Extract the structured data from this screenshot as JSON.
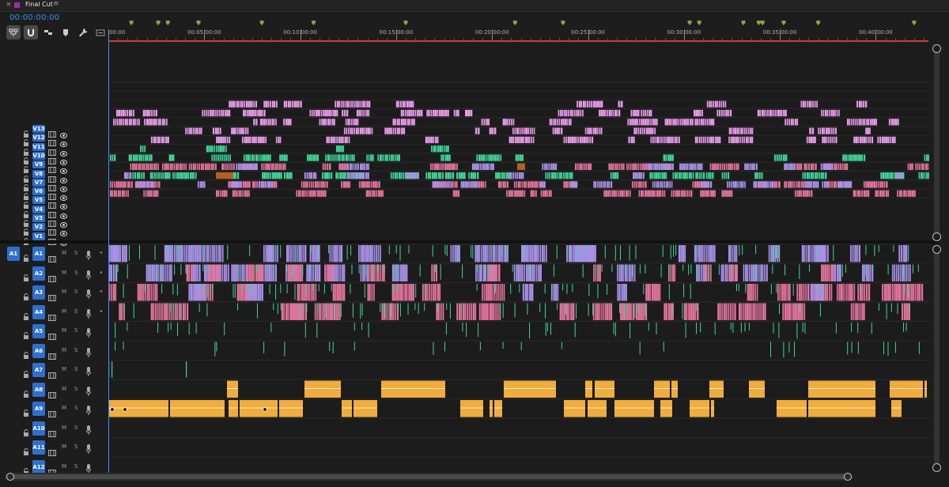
{
  "sequence": {
    "tab_close": "×",
    "title": "Final Cut",
    "menu_glyph": "≡",
    "swatch_color": "#9a2fa6",
    "timecode": "00:00:00:00"
  },
  "toolbar": {
    "tools": [
      {
        "name": "nest-icon",
        "active": true
      },
      {
        "name": "snap-magnet-icon",
        "active": true
      },
      {
        "name": "linked-selection-icon",
        "active": false
      },
      {
        "name": "add-marker-icon",
        "active": false
      },
      {
        "name": "timeline-settings-wrench-icon",
        "active": false
      },
      {
        "name": "captions-icon",
        "active": false
      }
    ]
  },
  "ruler": {
    "labels": [
      ":00:00",
      "00:05:00:00",
      "00:10:00:00",
      "00:15:00:00",
      "00:20:00:00",
      "00:25:00:00",
      "00:30:00:00",
      "00:35:00:00",
      "00:40:00:00"
    ],
    "total_minutes": 44,
    "marker_minutes": [
      1.2,
      2.6,
      3.1,
      4.7,
      8.0,
      10.7,
      15.5,
      21.2,
      23.7,
      30.3,
      30.8,
      33.1,
      33.9,
      34.1,
      35.2,
      37.0,
      42.0
    ],
    "marker_color": "#8fa041"
  },
  "video_tracks": [
    "V13",
    "V12",
    "V11",
    "V10",
    "V9",
    "V8",
    "V7",
    "V6",
    "V5",
    "V4",
    "V3",
    "V2",
    "V1"
  ],
  "audio_tracks": [
    "A1",
    "A2",
    "A3",
    "A4",
    "A5",
    "A6",
    "A7",
    "A8",
    "A9",
    "A10",
    "A11",
    "A12"
  ],
  "audio_source_patch": "A1",
  "audio_header_labels": {
    "mute": "M",
    "solo": "S"
  },
  "colors": {
    "accent": "#3f8df0",
    "clip_pink_light": "#e69ae8",
    "clip_purple": "#a791e6",
    "clip_rose": "#e0739b",
    "clip_green": "#3fd598",
    "clip_orange_audio": "#f0ac3c",
    "clip_brown": "#b65f23",
    "work_area_red": "#d33a32"
  }
}
